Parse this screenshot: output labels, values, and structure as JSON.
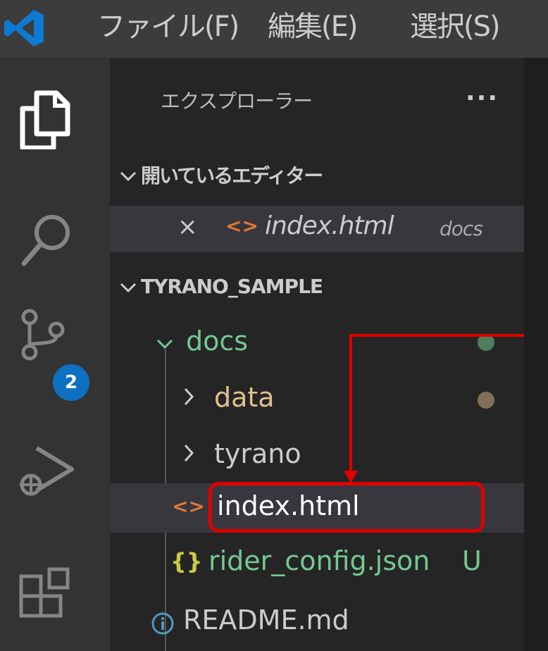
{
  "menu": {
    "file": "ファイル(F)",
    "edit": "編集(E)",
    "selection": "選択(S)"
  },
  "activity_bar": {
    "items": [
      "explorer-icon",
      "search-icon",
      "source-control-icon",
      "run-debug-icon",
      "extensions-icon"
    ],
    "source_control_badge": "2"
  },
  "explorer": {
    "title": "エクスプローラー",
    "more_actions": "...",
    "open_editors": {
      "section_label": "開いているエディター",
      "items": [
        {
          "close": "×",
          "name": "index.html",
          "folder": "docs"
        }
      ]
    },
    "workspace": {
      "label": "TYRANO_SAMPLE",
      "tree": [
        {
          "name": "docs",
          "kind": "folder",
          "expanded": true
        },
        {
          "name": "data",
          "kind": "folder",
          "expanded": false
        },
        {
          "name": "tyrano",
          "kind": "folder",
          "expanded": false
        },
        {
          "name": "index.html",
          "kind": "html-file"
        },
        {
          "name": "rider_config.json",
          "kind": "json-file",
          "status": "U"
        },
        {
          "name": "README.md",
          "kind": "info-file"
        }
      ]
    }
  },
  "colors": {
    "accent_badge": "#0e70c0",
    "highlight": "#e00000",
    "folder_green": "#73c991",
    "folder_yellow": "#e2c08d",
    "html_icon": "#e37933",
    "json_icon": "#cbcb41",
    "info_icon": "#519aba"
  }
}
